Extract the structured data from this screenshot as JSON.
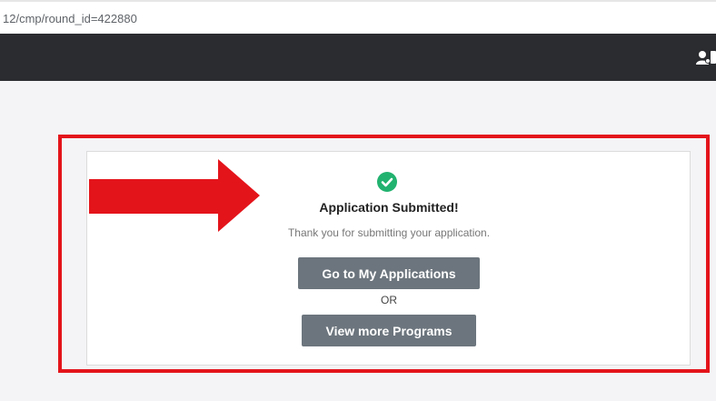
{
  "browser": {
    "url": "12/cmp/round_id=422880"
  },
  "navbar": {
    "user_icon": "user-award-icon"
  },
  "confirmation": {
    "icon": "check-circle-icon",
    "title": "Application Submitted!",
    "message": "Thank you for submitting your application.",
    "primary_button": "Go to My Applications",
    "separator": "OR",
    "secondary_button": "View more Programs"
  },
  "annotation": {
    "arrow_color": "#e4141b",
    "box_color": "#e4141b"
  },
  "colors": {
    "success": "#21b26f",
    "button": "#6c757d",
    "navbar": "#2a2c2f"
  }
}
